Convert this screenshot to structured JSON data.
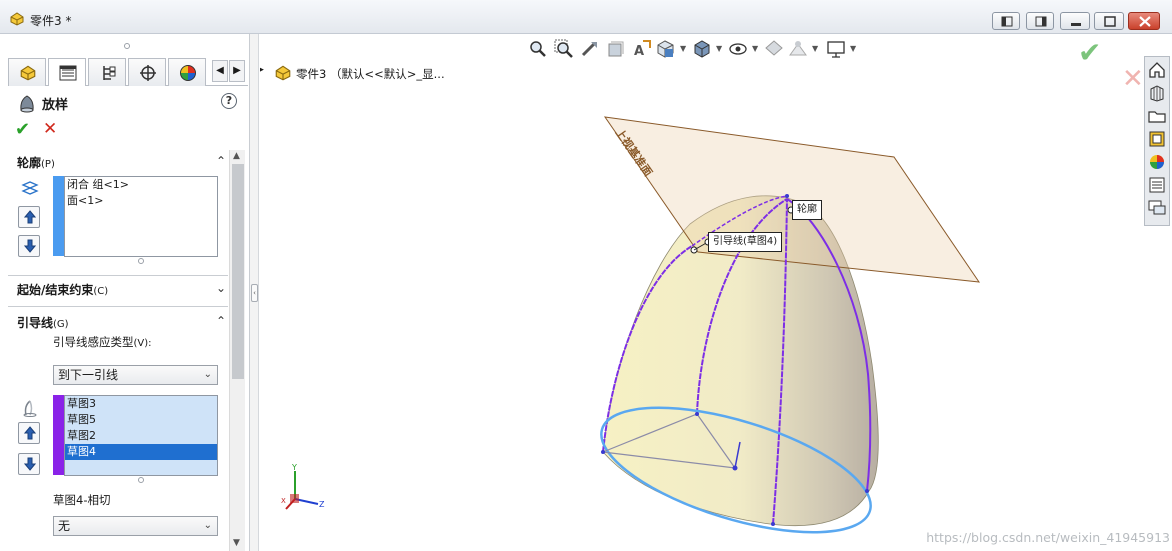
{
  "window": {
    "title": "零件3 *"
  },
  "panel": {
    "feature_title": "放样",
    "help": "?",
    "ok": "✔",
    "cancel": "✕",
    "tabscroll_left": "◀",
    "tabscroll_right": "▶",
    "profile": {
      "title": "轮廓",
      "hotkey": "(P)",
      "items": [
        "闭合 组<1>",
        "面<1>"
      ],
      "color": "#4a9bf0"
    },
    "start_end": {
      "title": "起始/结束约束",
      "hotkey": "(C)"
    },
    "guides": {
      "title": "引导线",
      "hotkey": "(G)",
      "influence_label": "引导线感应类型",
      "influence_hotkey": "(V):",
      "influence_value": "到下一引线",
      "items": [
        "草图3",
        "草图5",
        "草图2",
        "草图4"
      ],
      "selected_index": 3,
      "color": "#8a22e8",
      "tangency_label": "草图4-相切",
      "tangency_value": "无"
    }
  },
  "viewport": {
    "breadcrumb": "零件3 （默认<<默认>_显...",
    "callout_profile": "轮廓",
    "callout_guide": "引导线(草图4)",
    "plane_label": "上视基准面",
    "triad": {
      "x": "X",
      "y": "Y",
      "z": "Z"
    },
    "watermark": "https://blog.csdn.net/weixin_41945913"
  }
}
